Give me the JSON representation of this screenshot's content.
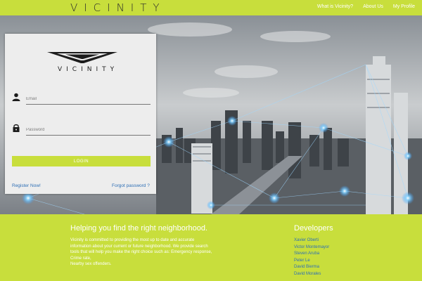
{
  "header": {
    "brand": "VICINITY",
    "nav": [
      "What is Vicinity?",
      "About Us",
      "My Profile"
    ]
  },
  "login": {
    "logo_text": "VICINITY",
    "email_placeholder": "Email",
    "password_placeholder": "Password",
    "login_label": "LOGIN",
    "register_label": "Register Now!",
    "forgot_label": "Forgot password ?"
  },
  "footer": {
    "tagline": "Helping you find the right neighborhood.",
    "description_lines": [
      "Vicinity is committed to providing the most up to date and accurate",
      "information about your current or future neighborhood. We provide search",
      "tools that will help you make the right choice such as: Emergency response,",
      "Crime rate,",
      "Nearby sex offenders."
    ],
    "developers_title": "Developers",
    "developers": [
      "Xavier Oberti",
      "Victor Montemayor",
      "Steven Aruba",
      "Peter Le",
      "David Bierma",
      "David Morales"
    ]
  },
  "colors": {
    "accent": "#c8de3c",
    "link": "#2e6fb5",
    "card": "#ededed"
  }
}
